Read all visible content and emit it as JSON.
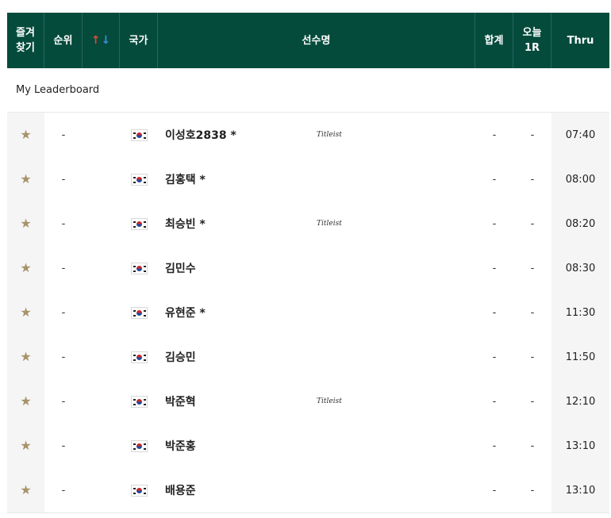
{
  "header": {
    "fav_line1": "즐겨",
    "fav_line2": "찾기",
    "rank": "순위",
    "country": "국가",
    "player": "선수명",
    "total": "합계",
    "today_line1": "오늘",
    "today_line2": "1R",
    "thru": "Thru"
  },
  "section_title": "My Leaderboard",
  "rows": [
    {
      "rank": "-",
      "name": "이성호2838 *",
      "sponsor": "Titleist",
      "total": "-",
      "today": "-",
      "thru": "07:40"
    },
    {
      "rank": "-",
      "name": "김홍택 *",
      "sponsor": "",
      "total": "-",
      "today": "-",
      "thru": "08:00"
    },
    {
      "rank": "-",
      "name": "최승빈 *",
      "sponsor": "Titleist",
      "total": "-",
      "today": "-",
      "thru": "08:20"
    },
    {
      "rank": "-",
      "name": "김민수",
      "sponsor": "",
      "total": "-",
      "today": "-",
      "thru": "08:30"
    },
    {
      "rank": "-",
      "name": "유현준 *",
      "sponsor": "",
      "total": "-",
      "today": "-",
      "thru": "11:30"
    },
    {
      "rank": "-",
      "name": "김승민",
      "sponsor": "",
      "total": "-",
      "today": "-",
      "thru": "11:50"
    },
    {
      "rank": "-",
      "name": "박준혁",
      "sponsor": "Titleist",
      "total": "-",
      "today": "-",
      "thru": "12:10"
    },
    {
      "rank": "-",
      "name": "박준홍",
      "sponsor": "",
      "total": "-",
      "today": "-",
      "thru": "13:10"
    },
    {
      "rank": "-",
      "name": "배용준",
      "sponsor": "",
      "total": "-",
      "today": "-",
      "thru": "13:10"
    }
  ],
  "icons": {
    "favorite": "star-icon",
    "sort": "sort-arrows-icon",
    "flag": "korea-flag-icon"
  },
  "colors": {
    "header_bg": "#044b3c",
    "star": "#a8936a",
    "sort_up": "#e04b33",
    "sort_down": "#3a8fe0"
  }
}
